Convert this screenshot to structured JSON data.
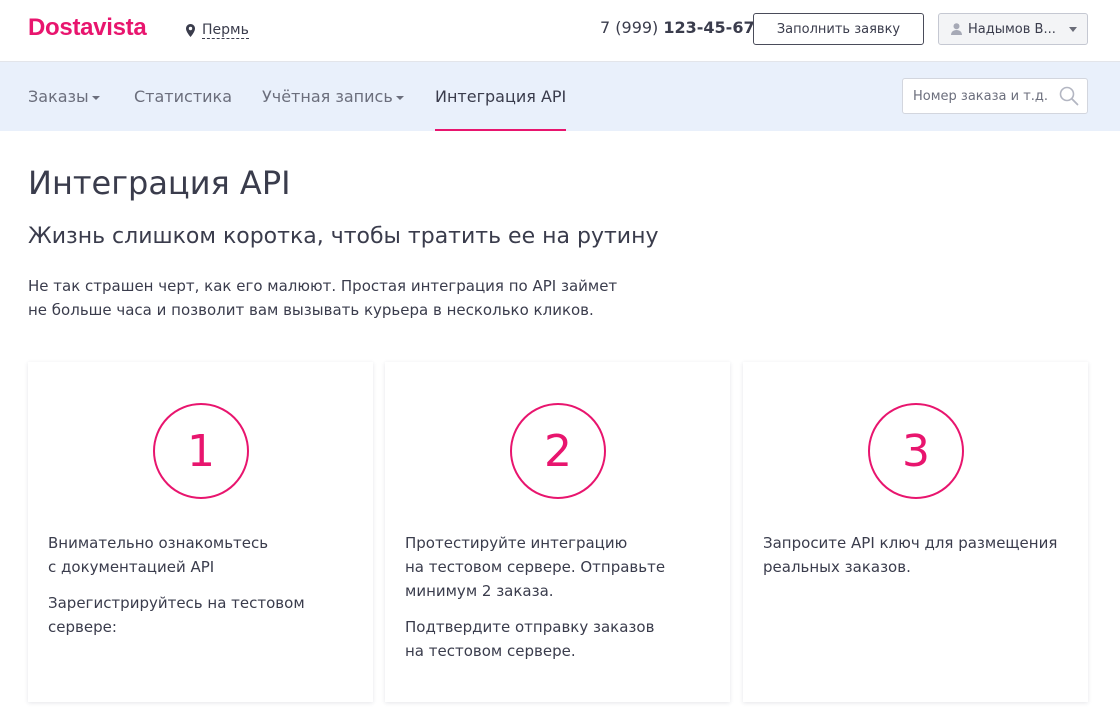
{
  "header": {
    "logo": "Dostavista",
    "city": "Пермь",
    "phone_prefix": "7 (999) ",
    "phone_main": "123-45-67",
    "order_button": "Заполнить заявку",
    "user_name": "Надымов В..."
  },
  "nav": {
    "items": [
      {
        "label": "Заказы",
        "dropdown": true
      },
      {
        "label": "Статистика",
        "dropdown": false
      },
      {
        "label": "Учётная запись",
        "dropdown": true
      },
      {
        "label": "Интеграция API",
        "dropdown": false,
        "active": true
      }
    ],
    "search_placeholder": "Номер заказа и т.д."
  },
  "main": {
    "title": "Интеграция API",
    "subtitle": "Жизнь слишком коротка, чтобы тратить ее на рутину",
    "intro_line1": "Не так страшен черт, как его малюют. Простая интеграция по API займет",
    "intro_line2": "не больше часа и позволит вам вызывать курьера в несколько кликов."
  },
  "steps": [
    {
      "number": "1",
      "paragraphs": [
        "Внимательно ознакомьтесь\nс документацией API",
        "Зарегистрируйтесь на тестовом\nсервере:"
      ]
    },
    {
      "number": "2",
      "paragraphs": [
        "Протестируйте интеграцию\nна тестовом сервере. Отправьте\nминимум 2 заказа.",
        "Подтвердите отправку заказов\nна тестовом сервере."
      ]
    },
    {
      "number": "3",
      "paragraphs": [
        "Запросите API ключ для размещения\nреальных заказов."
      ]
    }
  ],
  "colors": {
    "accent": "#e8156e",
    "nav_bg": "#e9f0fb",
    "text": "#3a3c4c"
  }
}
